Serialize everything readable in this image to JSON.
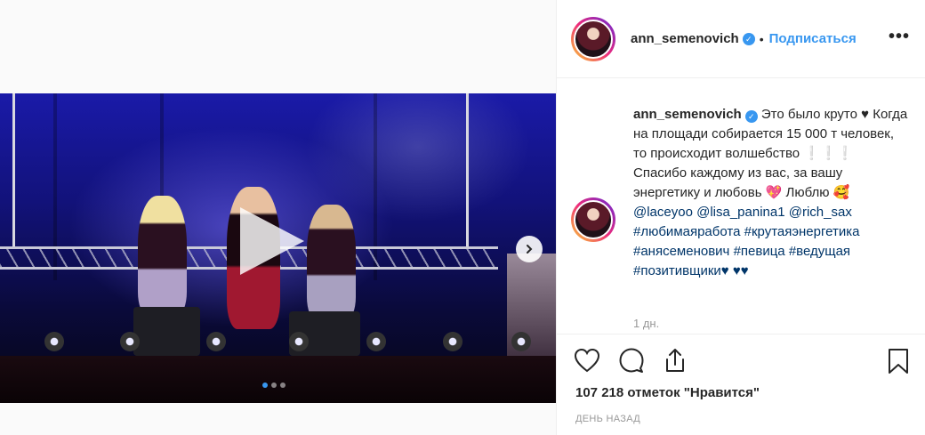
{
  "post": {
    "username": "ann_semenovich",
    "follow_label": "Подписаться",
    "separator": "•",
    "more_label": "•••",
    "caption_username": "ann_semenovich",
    "caption_part1": "Это было круто",
    "caption_part2": "♥ Когда на площади собирается 15 000 т человек, то происходит волшебство ❕❕❕ Спасибо каждому из вас, за вашу энергетику и любовь 💖 Люблю 🥰 ",
    "mentions": [
      "@laceyoo",
      "@lisa_panina1",
      "@rich_sax"
    ],
    "hashtags": [
      "#любимаяработа",
      "#крутаяэнергетика",
      "#анясеменович",
      "#певица",
      "#ведущая",
      "#позитивщики♥"
    ],
    "caption_end": "♥♥",
    "caption_time": "1 дн.",
    "likes": "107 218 отметок \"Нравится\"",
    "date": "ДЕНЬ НАЗАД"
  },
  "carousel": {
    "slides": 3,
    "active_index": 0
  },
  "colors": {
    "accent": "#3897f0",
    "link": "#003569",
    "muted": "#999999"
  },
  "icons": [
    "heart-icon",
    "comment-icon",
    "share-icon",
    "bookmark-icon",
    "chevron-right-icon",
    "play-icon",
    "verified-icon"
  ]
}
